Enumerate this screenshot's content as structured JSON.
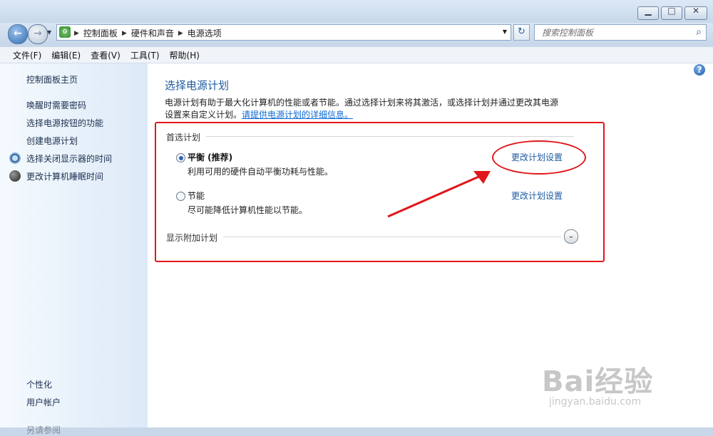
{
  "window": {
    "minimize_glyph": "▁",
    "maximize_glyph": "□",
    "close_glyph": "✕"
  },
  "nav": {
    "breadcrumb": [
      "控制面板",
      "硬件和声音",
      "电源选项"
    ],
    "search_placeholder": "搜索控制面板"
  },
  "menu": [
    "文件(F)",
    "编辑(E)",
    "查看(V)",
    "工具(T)",
    "帮助(H)"
  ],
  "sidebar": {
    "home": "控制面板主页",
    "items": [
      "唤醒时需要密码",
      "选择电源按钮的功能",
      "创建电源计划",
      "选择关闭显示器的时间",
      "更改计算机睡眠时间"
    ],
    "see_also": "另请参阅",
    "see_also_items": [
      "个性化",
      "用户帐户"
    ]
  },
  "main": {
    "title": "选择电源计划",
    "description": "电源计划有助于最大化计算机的性能或者节能。通过选择计划来将其激活，或选择计划并通过更改其电源设置来自定义计划。",
    "link": "请提供电源计划的详细信息。",
    "preferred_title": "首选计划",
    "plans": [
      {
        "name": "平衡 (推荐)",
        "description": "利用可用的硬件自动平衡功耗与性能。",
        "selected": true,
        "change_link": "更改计划设置"
      },
      {
        "name": "节能",
        "description": "尽可能降低计算机性能以节能。",
        "selected": false,
        "change_link": "更改计划设置"
      }
    ],
    "more_plans": "显示附加计划"
  },
  "watermark": {
    "text": "Bai经验",
    "url": "jingyan.baidu.com"
  },
  "colors": {
    "accent_blue": "#1d5a9f",
    "annotation_red": "#e1161b"
  }
}
